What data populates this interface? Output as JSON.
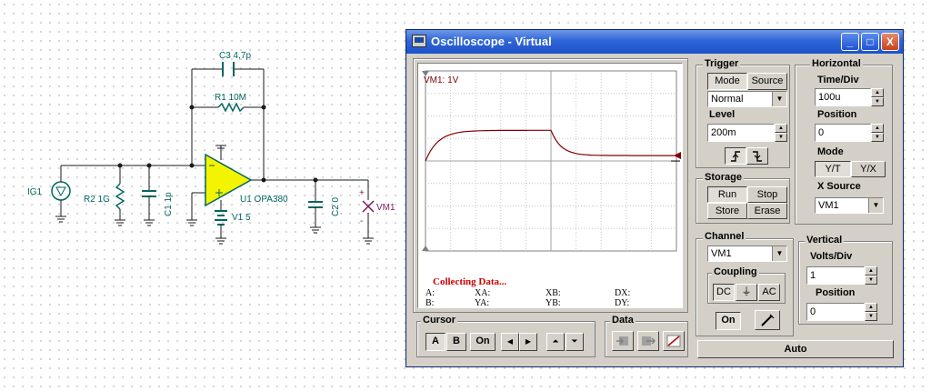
{
  "schematic": {
    "labels": {
      "c3": "C3 4,7p",
      "r1": "R1 10M",
      "ig1": "IG1",
      "r2": "R2 1G",
      "c1": "C1 1p",
      "u1": "U1 OPA380",
      "v1": "V1 5",
      "c2": "C2 0",
      "vm1": "VM1",
      "plus": "+",
      "minus": "-"
    }
  },
  "window": {
    "title": "Oscilloscope - Virtual",
    "minimize": "_",
    "maximize": "□",
    "close": "X"
  },
  "scope": {
    "channel_label": "VM1: 1V",
    "status": "Collecting Data...",
    "readouts": {
      "a": "A:",
      "b": "B:",
      "xa": "XA:",
      "ya": "YA:",
      "xb": "XB:",
      "yb": "YB:",
      "dx": "DX:",
      "dy": "DY:"
    },
    "trace_color": "#800000",
    "trace_level_fraction_rise": 0.17,
    "trace_level_fraction_final": 0.03
  },
  "trigger": {
    "title": "Trigger",
    "mode_label": "Mode",
    "source_label": "Source",
    "mode_value": "Normal",
    "level_label": "Level",
    "level_value": "200m",
    "rising_icon": "rising-edge",
    "falling_icon": "falling-edge"
  },
  "horizontal": {
    "title": "Horizontal",
    "timediv_label": "Time/Div",
    "timediv_value": "100u",
    "position_label": "Position",
    "position_value": "0",
    "mode_label": "Mode",
    "yt_label": "Y/T",
    "yx_label": "Y/X",
    "xsource_label": "X Source",
    "xsource_value": "VM1"
  },
  "storage": {
    "title": "Storage",
    "run": "Run",
    "stop": "Stop",
    "store": "Store",
    "erase": "Erase"
  },
  "channel": {
    "title": "Channel",
    "value": "VM1",
    "coupling_title": "Coupling",
    "dc": "DC",
    "gnd": "⏚",
    "ac": "AC",
    "on": "On"
  },
  "vertical": {
    "title": "Vertical",
    "voltsdiv_label": "Volts/Div",
    "voltsdiv_value": "1",
    "position_label": "Position",
    "position_value": "0"
  },
  "cursor": {
    "title": "Cursor",
    "a": "A",
    "b": "B",
    "on": "On",
    "left": "◀",
    "right": "▶",
    "up": "⏶",
    "down": "⏷"
  },
  "data": {
    "title": "Data"
  },
  "auto": "Auto"
}
